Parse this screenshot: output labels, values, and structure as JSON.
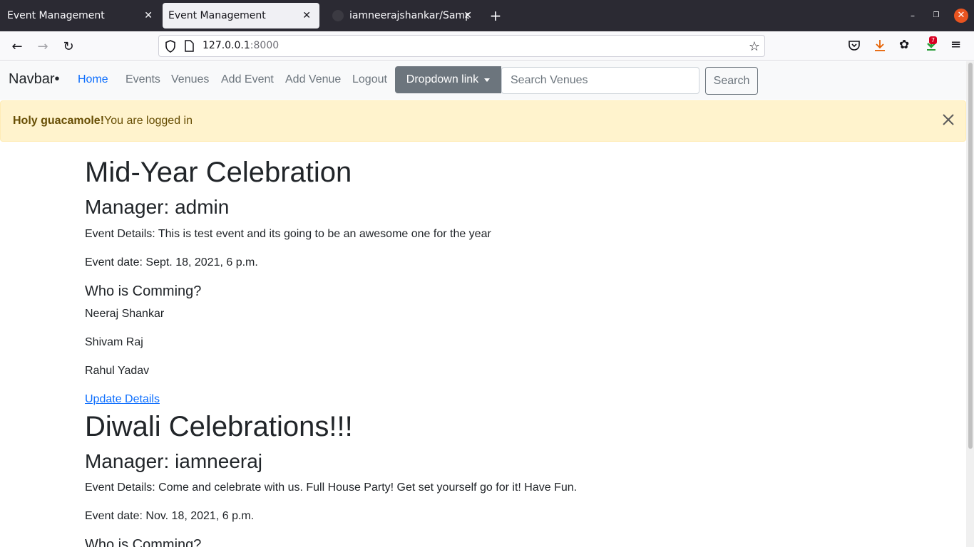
{
  "browser": {
    "tabs": [
      {
        "title": "Event Management"
      },
      {
        "title": "Event Management"
      },
      {
        "title": "iamneerajshankar/SampleDjango"
      }
    ],
    "url_host": "127.0.0.1",
    "url_port": ":8000",
    "downloads_badge": "7"
  },
  "navbar": {
    "brand": "Navbar•",
    "links": [
      "Home",
      "Events",
      "Venues",
      "Add Event",
      "Add Venue",
      "Logout"
    ],
    "dropdown_label": "Dropdown link",
    "search_placeholder": "Search Venues",
    "search_button": "Search"
  },
  "alert": {
    "strong": "Holy guacamole!",
    "text": "You are logged in"
  },
  "events": [
    {
      "title": "Mid-Year Celebration",
      "manager": "Manager: admin",
      "details": "Event Details: This is test event and its going to be an awesome one for the year",
      "date": "Event date: Sept. 18, 2021, 6 p.m.",
      "who_heading": "Who is Comming?",
      "attendees": [
        "Neeraj Shankar",
        "Shivam Raj",
        "Rahul Yadav"
      ],
      "update_link": "Update Details"
    },
    {
      "title": "Diwali Celebrations!!!",
      "manager": "Manager: iamneeraj",
      "details": "Event Details: Come and celebrate with us. Full House Party! Get set yourself go for it! Have Fun.",
      "date": "Event date: Nov. 18, 2021, 6 p.m.",
      "who_heading": "Who is Comming?"
    }
  ]
}
